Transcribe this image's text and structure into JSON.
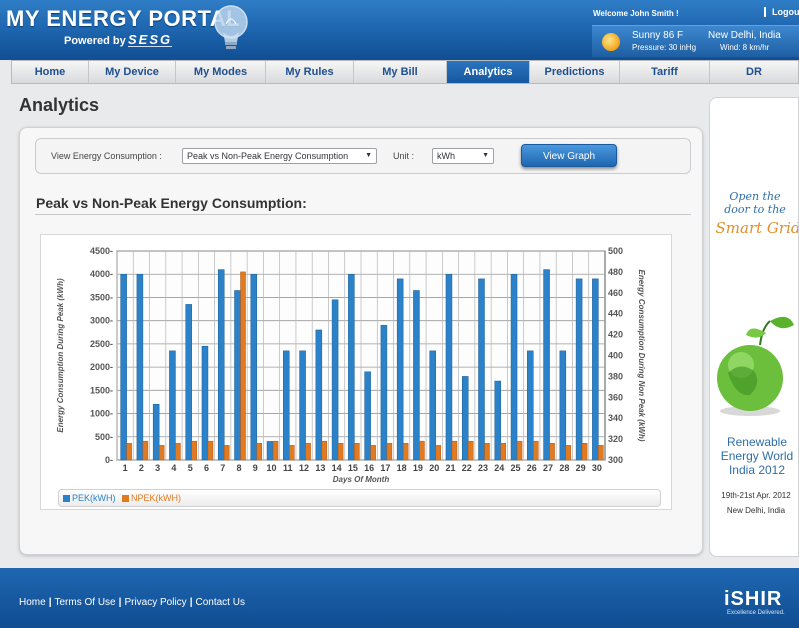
{
  "header": {
    "title": "MY ENERGY PORTAL",
    "powered_by": "Powered by",
    "brand": "SESG",
    "welcome": "Welcome John Smith !",
    "logout": "Logout",
    "weather": {
      "condition": "Sunny 86 F",
      "pressure": "Pressure: 30 inHg",
      "city": "New Delhi, India",
      "wind": "Wind: 8 km/hr"
    }
  },
  "nav": {
    "items": [
      {
        "label": "Home"
      },
      {
        "label": "My Device"
      },
      {
        "label": "My Modes"
      },
      {
        "label": "My Rules"
      },
      {
        "label": "My Bill"
      },
      {
        "label": "Analytics"
      },
      {
        "label": "Predictions"
      },
      {
        "label": "Tariff"
      },
      {
        "label": "DR"
      }
    ],
    "active": "Analytics"
  },
  "page": {
    "title": "Analytics",
    "filter": {
      "label": "View Energy Consumption :",
      "selected": "Peak vs Non-Peak Energy Consumption",
      "unit_label": "Unit :",
      "unit_selected": "kWh",
      "button": "View Graph"
    },
    "chart_heading": "Peak vs Non-Peak Energy Consumption:"
  },
  "chart_data": {
    "type": "bar",
    "xlabel": "Days Of Month",
    "ylabel": "Energy Consumption During Peak (kWh)",
    "y2label": "Energy Consumption During Non Peak (kWh)",
    "ylim": [
      0,
      4500
    ],
    "y2lim": [
      300,
      500
    ],
    "yticks": [
      "0-",
      "500-",
      "1000-",
      "1500-",
      "2000-",
      "2500-",
      "3000-",
      "3500-",
      "4000-",
      "4500-"
    ],
    "y2ticks": [
      "300",
      "320",
      "340",
      "360",
      "380",
      "400",
      "420",
      "440",
      "460",
      "480",
      "500"
    ],
    "categories": [
      "1",
      "2",
      "3",
      "4",
      "5",
      "6",
      "7",
      "8",
      "9",
      "10",
      "11",
      "12",
      "13",
      "14",
      "15",
      "16",
      "17",
      "18",
      "19",
      "20",
      "21",
      "22",
      "23",
      "24",
      "25",
      "26",
      "27",
      "28",
      "29",
      "30"
    ],
    "series": [
      {
        "name": "PEK(kWH)",
        "axis": "left",
        "color": "#2b82c9",
        "values": [
          4000,
          4000,
          1200,
          2350,
          3350,
          2450,
          4100,
          3650,
          4000,
          400,
          2350,
          2350,
          2800,
          3450,
          4000,
          1900,
          2900,
          3900,
          3650,
          2350,
          4000,
          1800,
          3900,
          1700,
          4000,
          2350,
          4100,
          2350,
          3900,
          3900
        ]
      },
      {
        "name": "NPEK(kWH)",
        "axis": "right",
        "color": "#e07b22",
        "values": [
          316,
          318,
          314,
          316,
          318,
          318,
          314,
          480,
          316,
          318,
          314,
          316,
          318,
          316,
          316,
          314,
          316,
          316,
          318,
          314,
          318,
          318,
          316,
          316,
          318,
          318,
          316,
          314,
          316,
          314
        ]
      }
    ],
    "grid": true,
    "legend": "bottom-left"
  },
  "ad": {
    "line1": "Open the",
    "line2": "door to the",
    "line3": "Smart Grid",
    "title1": "Renewable",
    "title2": "Energy World",
    "title3": "India 2012",
    "date": "19th-21st Apr. 2012",
    "place": "New Delhi, India"
  },
  "footer": {
    "links": [
      "Home",
      "Terms Of Use",
      "Privacy Policy",
      "Contact Us"
    ],
    "brand": "iSHIR",
    "tagline": "Excellence Delivered."
  }
}
